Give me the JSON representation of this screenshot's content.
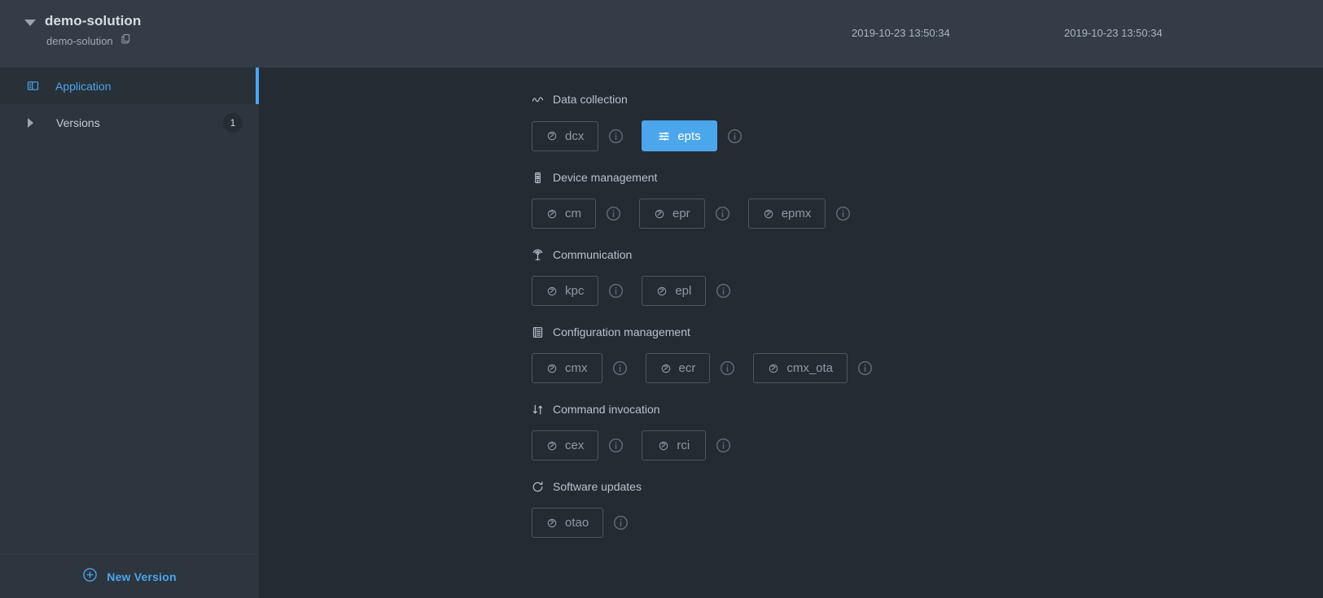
{
  "header": {
    "title": "demo-solution",
    "subtitle": "demo-solution",
    "copy_icon": "copy-icon",
    "caret_icon": "caret-down-icon",
    "timestamp_1": "2019-10-23 13:50:34",
    "timestamp_2": "2019-10-23 13:50:34"
  },
  "sidebar": {
    "items": [
      {
        "label": "Application",
        "icon": "application-icon",
        "active": true
      },
      {
        "label": "Versions",
        "icon": "caret-right-icon",
        "badge": "1",
        "active": false
      }
    ],
    "new_version": {
      "label": "New Version",
      "icon": "plus-circle-icon"
    }
  },
  "main": {
    "sections": [
      {
        "title": "Data collection",
        "icon": "activity-line-icon",
        "chips": [
          {
            "label": "dcx",
            "icon": "module-icon",
            "selected": false,
            "info": "info-icon"
          },
          {
            "label": "epts",
            "icon": "sliders-icon",
            "selected": true,
            "info": "info-icon"
          }
        ]
      },
      {
        "title": "Device management",
        "icon": "device-icon",
        "chips": [
          {
            "label": "cm",
            "icon": "module-icon",
            "selected": false,
            "info": "info-icon"
          },
          {
            "label": "epr",
            "icon": "module-icon",
            "selected": false,
            "info": "info-icon"
          },
          {
            "label": "epmx",
            "icon": "module-icon",
            "selected": false,
            "info": "info-icon"
          }
        ]
      },
      {
        "title": "Communication",
        "icon": "antenna-icon",
        "chips": [
          {
            "label": "kpc",
            "icon": "module-icon",
            "selected": false,
            "info": "info-icon"
          },
          {
            "label": "epl",
            "icon": "module-icon",
            "selected": false,
            "info": "info-icon"
          }
        ]
      },
      {
        "title": "Configuration management",
        "icon": "document-list-icon",
        "chips": [
          {
            "label": "cmx",
            "icon": "module-icon",
            "selected": false,
            "info": "info-icon"
          },
          {
            "label": "ecr",
            "icon": "module-icon",
            "selected": false,
            "info": "info-icon"
          },
          {
            "label": "cmx_ota",
            "icon": "module-icon",
            "selected": false,
            "info": "info-icon"
          }
        ]
      },
      {
        "title": "Command invocation",
        "icon": "exchange-arrows-icon",
        "chips": [
          {
            "label": "cex",
            "icon": "module-icon",
            "selected": false,
            "info": "info-icon"
          },
          {
            "label": "rci",
            "icon": "module-icon",
            "selected": false,
            "info": "info-icon"
          }
        ]
      },
      {
        "title": "Software updates",
        "icon": "refresh-icon",
        "chips": [
          {
            "label": "otao",
            "icon": "module-icon",
            "selected": false,
            "info": "info-icon"
          }
        ]
      }
    ]
  },
  "colors": {
    "accent": "#4ba6ec",
    "header_bg": "#343d47",
    "sidebar_bg": "#2d353e",
    "main_bg": "#252b33",
    "chip_border": "#4c5763"
  }
}
